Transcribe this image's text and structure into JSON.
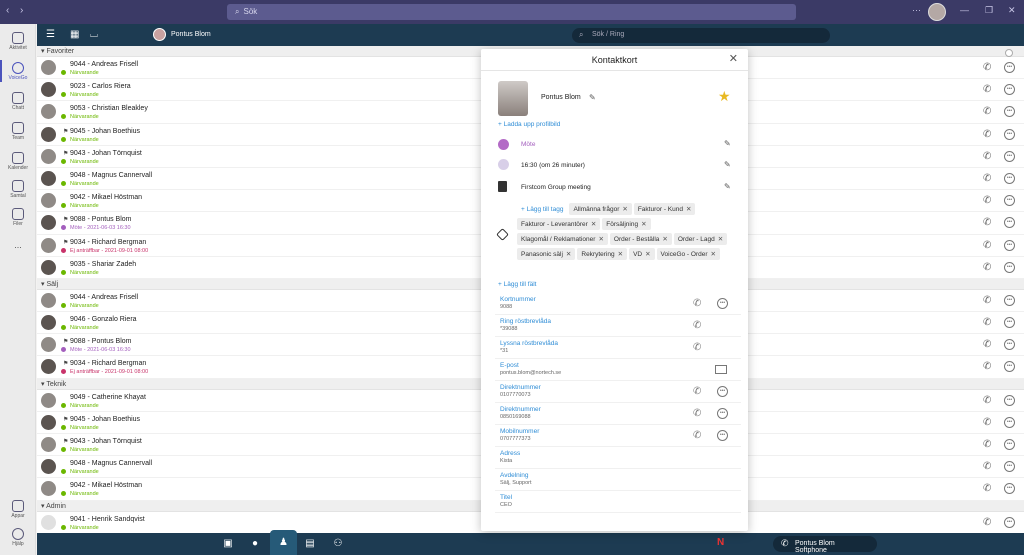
{
  "titlebar": {
    "search_placeholder": "Sök",
    "back": "‹",
    "forward": "›"
  },
  "rail": {
    "items": [
      {
        "label": "Aktivitet",
        "icon": "bell-icon"
      },
      {
        "label": "VoiceGo",
        "icon": "voicego-icon"
      },
      {
        "label": "Chatt",
        "icon": "chat-icon"
      },
      {
        "label": "Team",
        "icon": "team-icon"
      },
      {
        "label": "Kalender",
        "icon": "calendar-icon"
      },
      {
        "label": "Samtal",
        "icon": "phone-icon"
      },
      {
        "label": "Filer",
        "icon": "file-icon"
      },
      {
        "label": "...",
        "icon": "more-icon"
      }
    ],
    "bottom_items": [
      {
        "label": "Appar",
        "icon": "apps-icon"
      },
      {
        "label": "Hjälp",
        "icon": "help-icon"
      }
    ]
  },
  "header": {
    "user_name": "Pontus Blom",
    "search_placeholder": "Sök / Ring"
  },
  "groups": [
    {
      "name": "Favoriter",
      "rows": [
        {
          "name": "9044 - Andreas Frisell",
          "status": "Närvarande",
          "state": "available"
        },
        {
          "name": "9023 - Carlos Riera",
          "status": "Närvarande",
          "state": "available"
        },
        {
          "name": "9053 - Christian Bleakley",
          "status": "Närvarande",
          "state": "available"
        },
        {
          "name": "9045 - Johan Boethius",
          "status": "Närvarande",
          "state": "available"
        },
        {
          "name": "9043 - Johan Törnquist",
          "status": "Närvarande",
          "state": "available"
        },
        {
          "name": "9048 - Magnus Cannervall",
          "status": "Närvarande",
          "state": "available"
        },
        {
          "name": "9042 - Mikael Höstman",
          "status": "Närvarande",
          "state": "available"
        },
        {
          "name": "9088 - Pontus Blom",
          "status": "Möte - 2021-06-03 16:30",
          "state": "meeting"
        },
        {
          "name": "9034 - Richard Bergman",
          "status": "Ej anträffbar - 2021-09-01 08:00",
          "state": "away"
        },
        {
          "name": "9035 - Shariar Zadeh",
          "status": "Närvarande",
          "state": "available"
        }
      ]
    },
    {
      "name": "Sälj",
      "rows": [
        {
          "name": "9044 - Andreas Frisell",
          "status": "Närvarande",
          "state": "available"
        },
        {
          "name": "9046 - Gonzalo Riera",
          "status": "Närvarande",
          "state": "available"
        },
        {
          "name": "9088 - Pontus Blom",
          "status": "Möte - 2021-06-03 16:30",
          "state": "meeting"
        },
        {
          "name": "9034 - Richard Bergman",
          "status": "Ej anträffbar - 2021-09-01 08:00",
          "state": "away"
        }
      ]
    },
    {
      "name": "Teknik",
      "rows": [
        {
          "name": "9049 - Catherine Khayat",
          "status": "Närvarande",
          "state": "available"
        },
        {
          "name": "9045 - Johan Boethius",
          "status": "Närvarande",
          "state": "available"
        },
        {
          "name": "9043 - Johan Törnquist",
          "status": "Närvarande",
          "state": "available"
        },
        {
          "name": "9048 - Magnus Cannervall",
          "status": "Närvarande",
          "state": "available"
        },
        {
          "name": "9042 - Mikael Höstman",
          "status": "Närvarande",
          "state": "available"
        }
      ]
    },
    {
      "name": "Admin",
      "rows": [
        {
          "name": "9041 - Henrik Sandqvist",
          "status": "Närvarande",
          "state": "available"
        }
      ]
    }
  ],
  "card": {
    "title": "Kontaktkort",
    "name": "Pontus Blom",
    "upload_photo": "+ Ladda upp profilbild",
    "status": "Möte",
    "time": "16:30 (om 26 minuter)",
    "note": "Firstcom Group meeting",
    "add_tag": "+ Lägg till tagg",
    "tags": [
      "Allmänna frågor",
      "Fakturor - Kund",
      "Fakturor - Leverantörer",
      "Försäljning",
      "Klagomål / Reklamationer",
      "Order - Beställa",
      "Order - Lagd",
      "Panasonic sälj",
      "Rekrytering",
      "VD",
      "VoiceGo - Order"
    ],
    "tag_remove": "✕",
    "add_field": "+ Lägg till fält",
    "fields": [
      {
        "label": "Kortnummer",
        "value": "9088",
        "actions": [
          "call",
          "chat"
        ]
      },
      {
        "label": "Ring röstbrevlåda",
        "value": "*39088",
        "actions": [
          "call"
        ]
      },
      {
        "label": "Lyssna röstbrevlåda",
        "value": "*31",
        "actions": [
          "call"
        ]
      },
      {
        "label": "E-post",
        "value": "pontus.blom@nortech.se",
        "actions": [
          "mail"
        ]
      },
      {
        "label": "Direktnummer",
        "value": "0107770073",
        "actions": [
          "call",
          "chat"
        ]
      },
      {
        "label": "Direktnummer",
        "value": "0850169088",
        "actions": [
          "call",
          "chat"
        ]
      },
      {
        "label": "Mobilnummer",
        "value": "0707777373",
        "actions": [
          "call",
          "chat"
        ]
      },
      {
        "label": "Adress",
        "value": "Kista",
        "actions": []
      },
      {
        "label": "Avdelning",
        "value": "Sälj, Support",
        "actions": []
      },
      {
        "label": "Titel",
        "value": "CEO",
        "actions": []
      }
    ]
  },
  "bottombar": {
    "softphone_label": "Pontus Blom Softphone",
    "voicemail_badge": "N"
  },
  "colors": {
    "available": "#6bb700",
    "meeting": "#a35ebd",
    "away": "#c8336a",
    "header": "#1d3b52",
    "titlebar": "#3b3a66",
    "link": "#2f8dd6"
  }
}
